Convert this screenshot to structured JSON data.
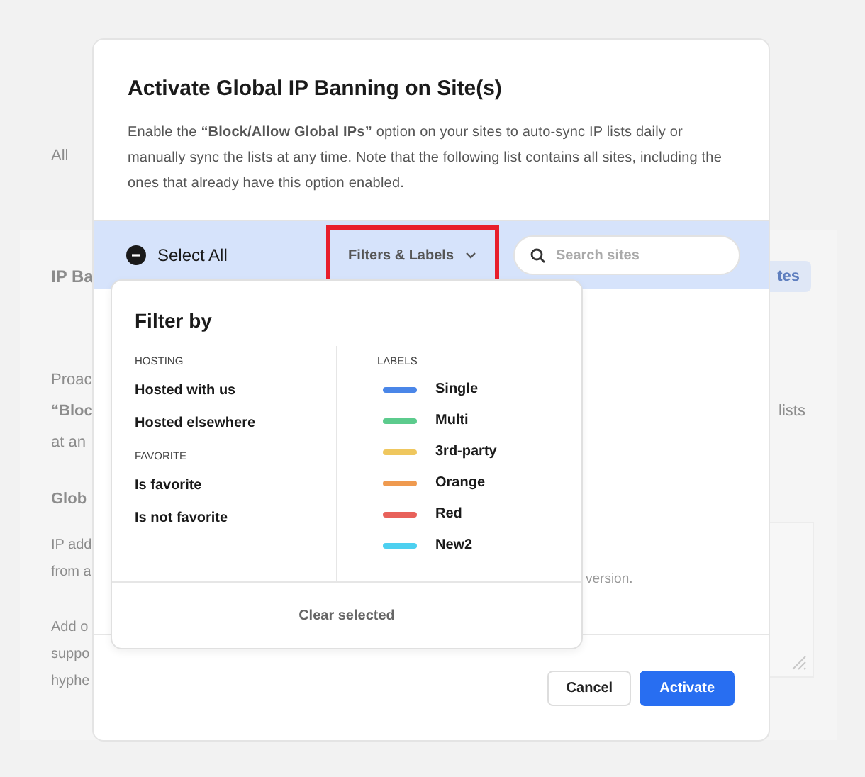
{
  "page": {
    "filter_tab": "All",
    "section_title": "IP Ba",
    "section_button": "tes",
    "intro_lines": [
      {
        "left": "Proac"
      },
      {
        "left": "“Bloc",
        "right": "lists"
      },
      {
        "left": "at an"
      }
    ],
    "field_title": "Glob",
    "field_lines": [
      "IP add",
      "from a"
    ],
    "help_lines": [
      "Add o",
      "suppo",
      "hyphe"
    ]
  },
  "modal": {
    "title": "Activate Global IP Banning on Site(s)",
    "description": "Enable the **“Block/Allow Global IPs”** option on your sites to auto-sync IP lists daily or manually sync the lists at any time. Note that the following list contains all sites, including the ones that already have this option enabled.",
    "select_all": {
      "label": "Select All",
      "indeterminate": true
    },
    "filters_button": {
      "label": "Filters & Labels",
      "highlighted": true
    },
    "search": {
      "placeholder": "Search sites"
    },
    "list_note": "version.",
    "dropdown": {
      "title": "Filter by",
      "groups": [
        {
          "heading": "HOSTING",
          "items": [
            "Hosted with us",
            "Hosted elsewhere"
          ]
        },
        {
          "heading": "FAVORITE",
          "items": [
            "Is favorite",
            "Is not favorite"
          ]
        }
      ],
      "labels_heading": "LABELS",
      "labels": [
        {
          "name": "Single",
          "color": "#4a86e8"
        },
        {
          "name": "Multi",
          "color": "#5ccb8d"
        },
        {
          "name": "3rd-party",
          "color": "#efc75e"
        },
        {
          "name": "Orange",
          "color": "#ef9a4f"
        },
        {
          "name": "Red",
          "color": "#e8615a"
        },
        {
          "name": "New2",
          "color": "#4dd0f0"
        }
      ],
      "clear": "Clear selected"
    },
    "buttons": [
      {
        "label": "Cancel",
        "kind": "secondary"
      },
      {
        "label": "Activate",
        "kind": "primary"
      }
    ]
  }
}
